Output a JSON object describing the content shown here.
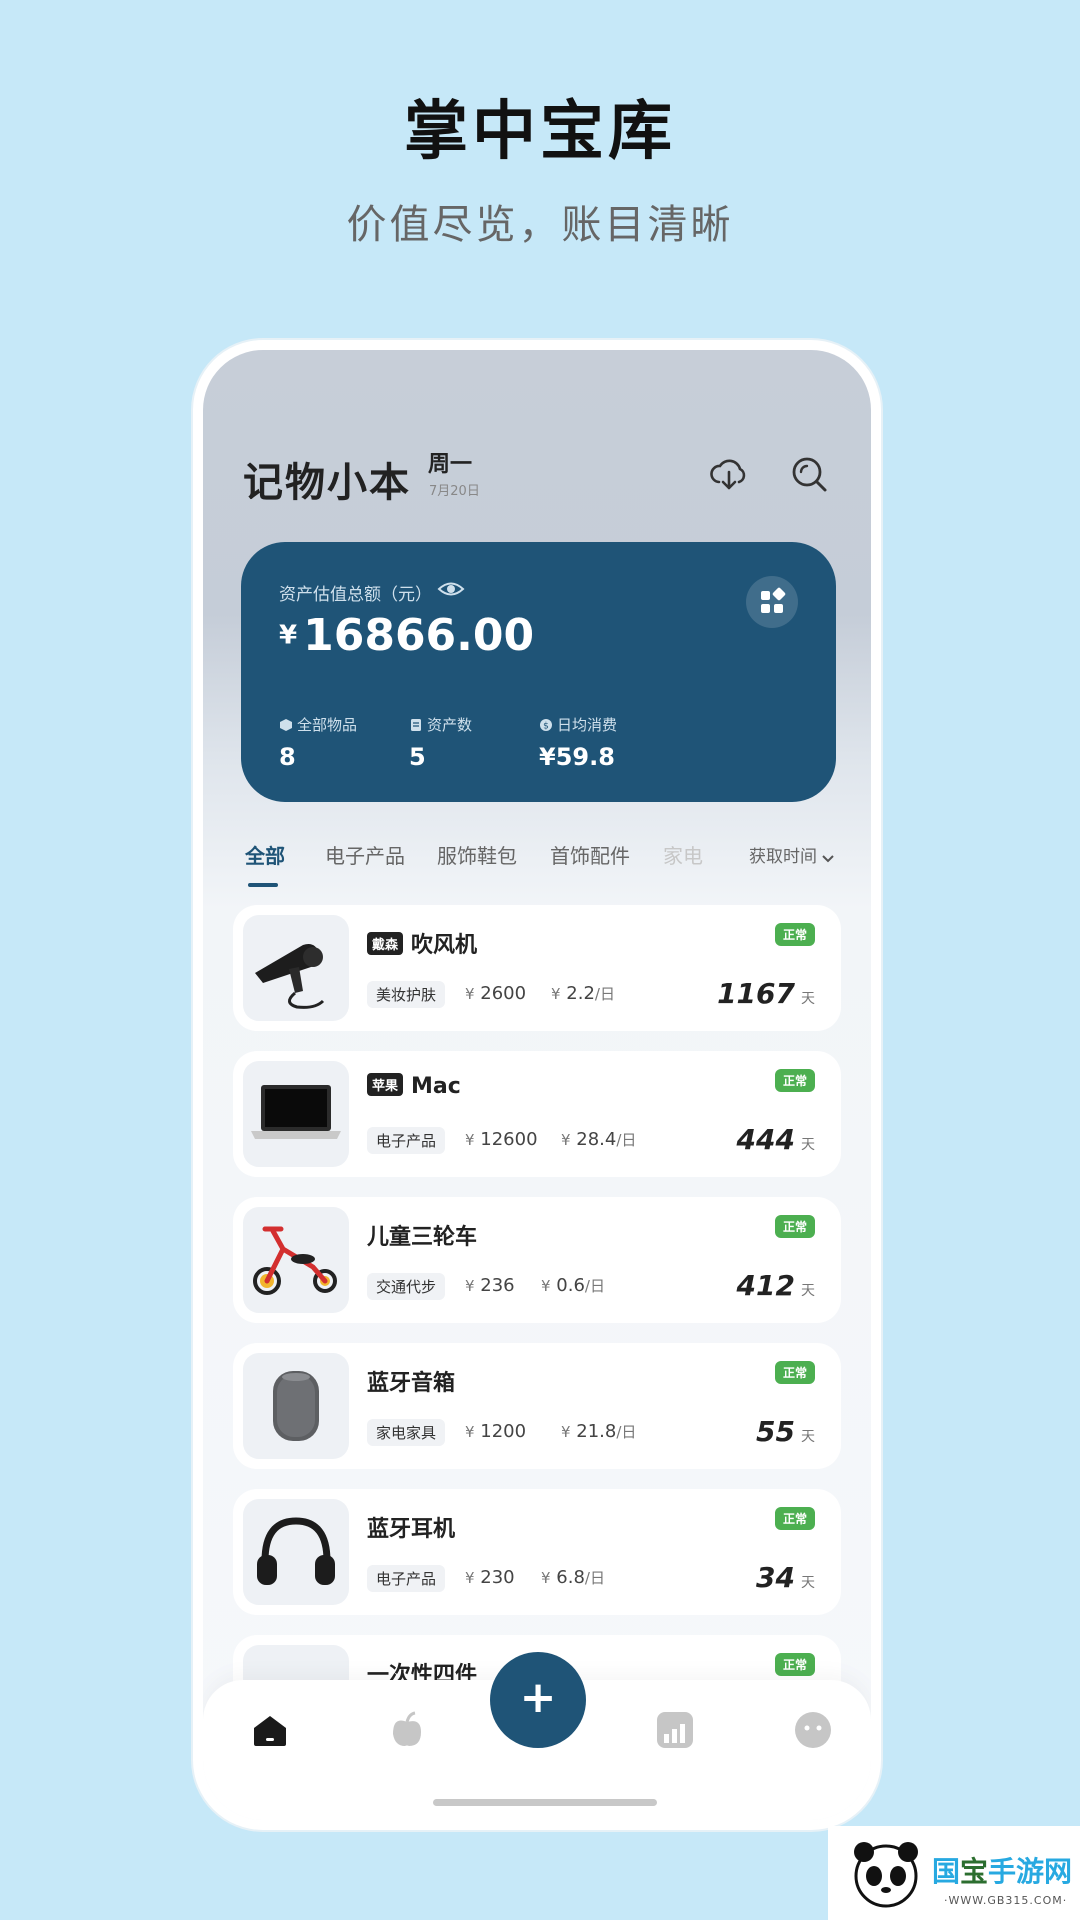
{
  "hero": {
    "title": "掌中宝库",
    "subtitle": "价值尽览，账目清晰"
  },
  "header": {
    "app_name": "记物小本",
    "weekday": "周一",
    "date": "7月20日",
    "icons": [
      "cloud-download-icon",
      "search-icon"
    ]
  },
  "asset_card": {
    "label": "资产估值总额（元）",
    "currency": "¥",
    "total": "16866.00",
    "stats": [
      {
        "label": "全部物品",
        "value": "8",
        "icon": "box-icon"
      },
      {
        "label": "资产数",
        "value": "5",
        "icon": "doc-icon"
      },
      {
        "label": "日均消费",
        "value": "¥59.8",
        "icon": "coin-icon"
      }
    ]
  },
  "tabs": [
    {
      "label": "全部",
      "active": true
    },
    {
      "label": "电子产品"
    },
    {
      "label": "服饰鞋包"
    },
    {
      "label": "首饰配件"
    },
    {
      "label": "家电"
    }
  ],
  "sort_label": "获取时间",
  "items": [
    {
      "brand": "戴森",
      "name": "吹风机",
      "category": "美妆护肤",
      "price": "2600",
      "daily": "2.2",
      "days": "1167",
      "status": "正常",
      "thumb": "hair-dryer"
    },
    {
      "brand": "苹果",
      "name": "Mac",
      "category": "电子产品",
      "price": "12600",
      "daily": "28.4",
      "days": "444",
      "status": "正常",
      "thumb": "laptop"
    },
    {
      "brand": "",
      "name": "儿童三轮车",
      "category": "交通代步",
      "price": "236",
      "daily": "0.6",
      "days": "412",
      "status": "正常",
      "thumb": "tricycle"
    },
    {
      "brand": "",
      "name": "蓝牙音箱",
      "category": "家电家具",
      "price": "1200",
      "daily": "21.8",
      "days": "55",
      "status": "正常",
      "thumb": "speaker"
    },
    {
      "brand": "",
      "name": "蓝牙耳机",
      "category": "电子产品",
      "price": "230",
      "daily": "6.8",
      "days": "34",
      "status": "正常",
      "thumb": "headphones"
    },
    {
      "brand": "",
      "name": "一次性四件",
      "category": "",
      "price": "",
      "daily": "",
      "days": "",
      "status": "正常",
      "thumb": "blank"
    }
  ],
  "units": {
    "yen": "¥",
    "per_day": "/日",
    "day": "天"
  },
  "nav": {
    "add_label": "+",
    "icons": [
      "home-icon",
      "fruit-icon",
      "chart-icon",
      "profile-icon"
    ]
  },
  "watermark": {
    "text_a": "国",
    "text_b": "宝",
    "text_c": "手游网",
    "url": "·WWW.GB315.COM·"
  },
  "colors": {
    "background": "#c6e8f8",
    "accent": "#1f5477",
    "status": "#4caf50"
  }
}
